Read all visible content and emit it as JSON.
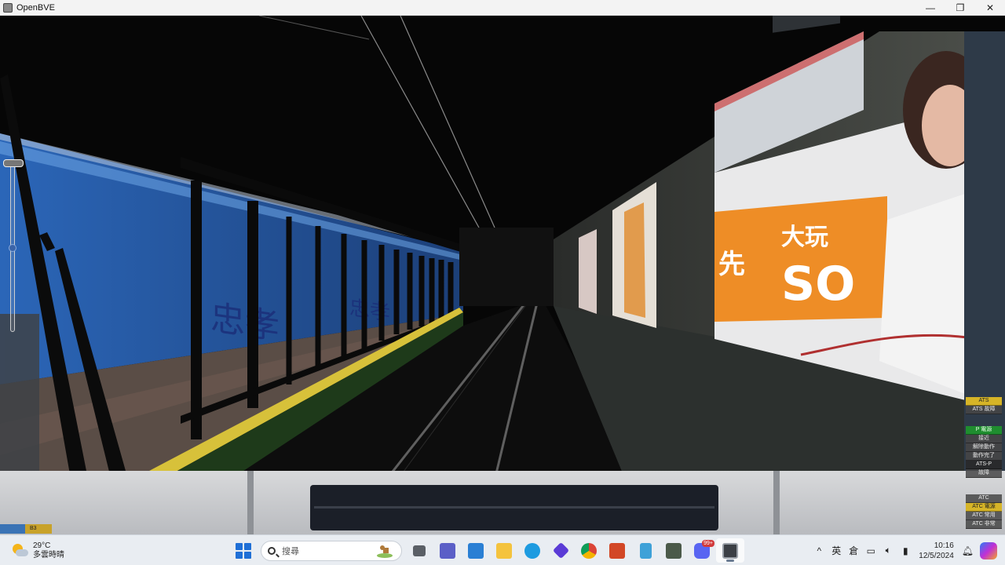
{
  "window": {
    "title": "OpenBVE",
    "controls": {
      "minimize": "—",
      "maximize": "❐",
      "close": "✕"
    }
  },
  "hud": {
    "left_strip": {
      "a": "",
      "b": "B3"
    },
    "indicators": {
      "group1": [
        "ATS",
        "ATS 故障"
      ],
      "group2": [
        "P 電源",
        "接近",
        "解除動作",
        "動作完了",
        "ATS-P",
        "故障"
      ],
      "group3": [
        "ATC",
        "ATC 電源",
        "ATC 常用",
        "ATC 非常"
      ]
    }
  },
  "ad": {
    "line1a": "先",
    "line1b": "大玩",
    "line2": "SO"
  },
  "taskbar": {
    "weather": {
      "temp": "29°C",
      "desc": "多雲時晴"
    },
    "search_placeholder": "搜尋",
    "discord_badge": "99+",
    "tray": {
      "chevron": "^",
      "ime1": "英",
      "ime2": "倉"
    },
    "clock": {
      "time": "10:16",
      "date": "12/5/2024"
    }
  },
  "colors": {
    "wall_blue": "#2f73c9",
    "platform_edge": "#d7c13a",
    "ad_orange": "#ee8d26"
  }
}
